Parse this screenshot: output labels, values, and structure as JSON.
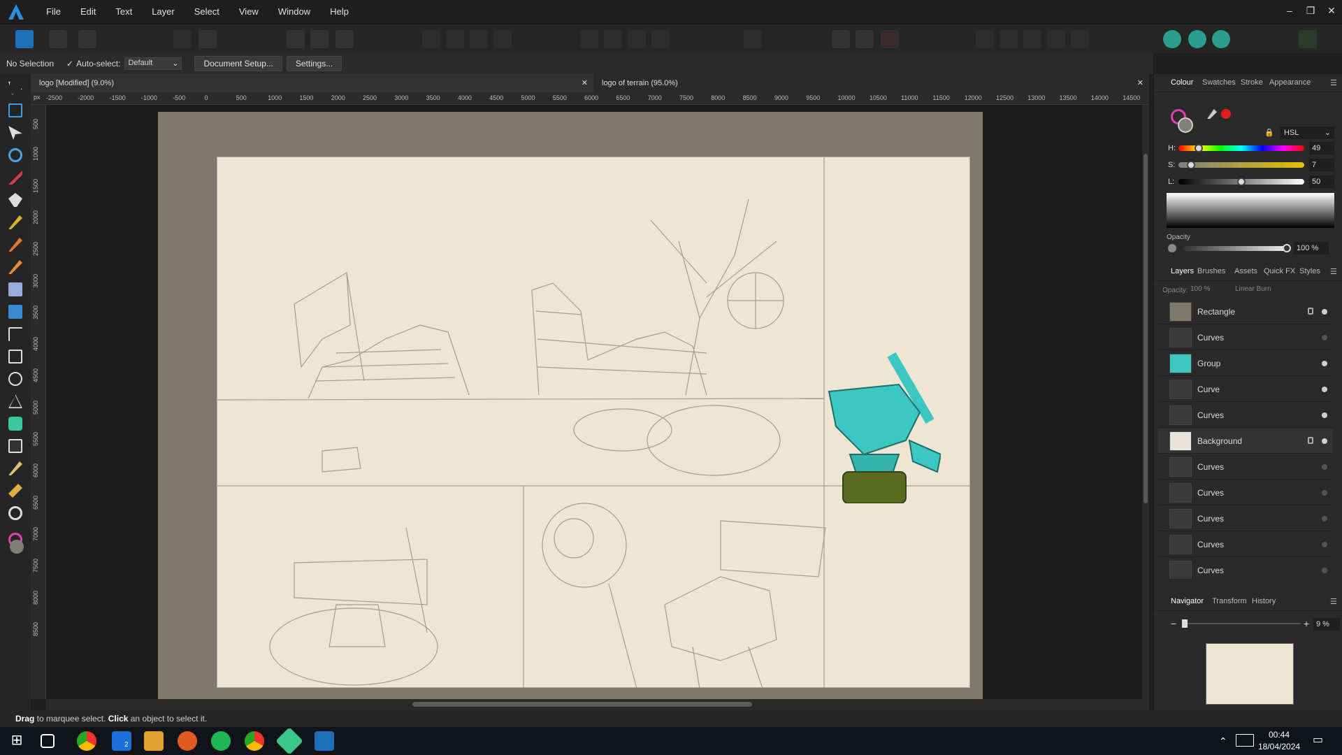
{
  "menu": {
    "items": [
      "File",
      "Edit",
      "Text",
      "Layer",
      "Select",
      "View",
      "Window",
      "Help"
    ]
  },
  "window_controls": {
    "minimize": "–",
    "restore": "❐",
    "close": "✕"
  },
  "context_bar": {
    "selection": "No Selection",
    "autoselect_label": "Auto-select:",
    "autoselect_value": "Default",
    "document_setup": "Document Setup...",
    "settings": "Settings..."
  },
  "doc_tabs": [
    {
      "label": "logo [Modified] (9.0%)",
      "close": "✕"
    },
    {
      "label": "logo of terrain (95.0%)",
      "close": "✕"
    }
  ],
  "ruler": {
    "h_ticks": [
      "-2500",
      "-2000",
      "-1500",
      "-1000",
      "-500",
      "0",
      "500",
      "1000",
      "1500",
      "2000",
      "2500",
      "3000",
      "3500",
      "4000",
      "4500",
      "5000",
      "5500",
      "6000",
      "6500",
      "7000",
      "7500",
      "8000",
      "8500",
      "9000",
      "9500",
      "10000",
      "10500",
      "11000",
      "11500",
      "12000",
      "12500",
      "13000",
      "13500",
      "14000",
      "14500"
    ],
    "v_ticks": [
      "500",
      "1000",
      "1500",
      "2000",
      "2500",
      "3000",
      "3500",
      "4000",
      "4500",
      "5000",
      "5500",
      "6000",
      "6500",
      "7000",
      "7500",
      "8000",
      "8500"
    ],
    "unit": "px"
  },
  "colour_panel": {
    "tabs": [
      "Colour",
      "Swatches",
      "Stroke",
      "Appearance"
    ],
    "model": "HSL",
    "h_label": "H:",
    "h_value": "49",
    "s_label": "S:",
    "s_value": "7",
    "l_label": "L:",
    "l_value": "50",
    "opacity_label": "Opacity",
    "opacity_value": "100 %",
    "h_fraction": 0.136,
    "s_fraction": 0.07,
    "l_fraction": 0.5
  },
  "layers_panel": {
    "tabs": [
      "Layers",
      "Brushes",
      "Assets",
      "Quick FX",
      "Styles"
    ],
    "opacity_label": "Opacity:",
    "opacity_value": "100 %",
    "blend_mode": "Linear Burn",
    "layers": [
      {
        "name": "Rectangle",
        "locked": true,
        "visible": true
      },
      {
        "name": "Curves",
        "locked": false,
        "visible": false
      },
      {
        "name": "Group",
        "locked": false,
        "visible": true
      },
      {
        "name": "Curve",
        "locked": false,
        "visible": true
      },
      {
        "name": "Curves",
        "locked": false,
        "visible": true
      },
      {
        "name": "Background",
        "locked": true,
        "visible": true
      },
      {
        "name": "Curves",
        "locked": false,
        "visible": false
      },
      {
        "name": "Curves",
        "locked": false,
        "visible": false
      },
      {
        "name": "Curves",
        "locked": false,
        "visible": false
      },
      {
        "name": "Curves",
        "locked": false,
        "visible": false
      },
      {
        "name": "Curves",
        "locked": false,
        "visible": false
      }
    ]
  },
  "navigator_panel": {
    "tabs": [
      "Navigator",
      "Transform",
      "History"
    ],
    "zoom": "9 %",
    "minus": "−",
    "plus": "+"
  },
  "status": {
    "bold1": "Drag",
    "text1": " to marquee select. ",
    "bold2": "Click",
    "text2": " an object to select it."
  },
  "taskbar": {
    "time": "00:44",
    "date": "18/04/2024",
    "badge": "2"
  },
  "colors": {
    "accent": "#2a8fd8",
    "teal": "#3cc7c0",
    "paper": "#ece6d3",
    "artboard": "#7d7a6a"
  }
}
